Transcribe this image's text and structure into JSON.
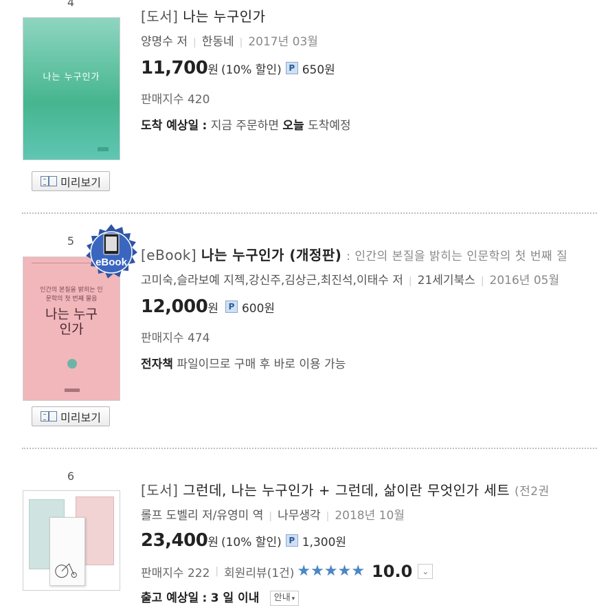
{
  "items": [
    {
      "rank": "4",
      "cover_title": "나는 누구인가",
      "preview_label": "미리보기",
      "category": "[도서]",
      "title": "나는 누구인가",
      "author": "양명수 저",
      "publisher": "한동네",
      "date": "2017년 03월",
      "price": "11,700",
      "won": "원",
      "discount": "(10% 할인)",
      "point_badge": "P",
      "points": "650원",
      "sales": "판매지수 420",
      "info_label": "도착 예상일",
      "info_colon": ":",
      "info_text1": "지금 주문하면",
      "info_bold": "오늘",
      "info_text2": "도착예정",
      "cover_color": "#5bbf9f"
    },
    {
      "rank": "5",
      "ebook_badge": "eBook",
      "cover_subtitle": "인간의 본질을 밝히는 인문학의 첫 번째 물음",
      "cover_title": "나는 누구인가",
      "preview_label": "미리보기",
      "category": "[eBook]",
      "title": "나는 누구인가 (개정판)",
      "subtitle": ": 인간의 본질을 밝히는 인문학의 첫 번째 질",
      "author": "고미숙,슬라보예 지젝,강신주,김상근,최진석,이태수 저",
      "publisher": "21세기북스",
      "date": "2016년 05월",
      "price": "12,000",
      "won": "원",
      "point_badge": "P",
      "points": "600원",
      "sales": "판매지수 474",
      "info_bold": "전자책",
      "info_text1": "파일이므로 구매 후 바로 이용 가능",
      "cover_color": "#f2b8bd"
    },
    {
      "rank": "6",
      "category": "[도서]",
      "title": "그런데, 나는 누구인가 + 그런데, 삶이란 무엇인가 세트",
      "subtitle": "(전2권",
      "author": "롤프 도벨리 저/유영미 역",
      "publisher": "나무생각",
      "date": "2018년 10월",
      "price": "23,400",
      "won": "원",
      "discount": "(10% 할인)",
      "point_badge": "P",
      "points": "1,300원",
      "sales": "판매지수 222",
      "reviews": "회원리뷰(1건)",
      "rating": "10.0",
      "rating_value": 5,
      "info_label": "출고 예상일",
      "info_colon": ":",
      "info_value": "3 일 이내",
      "guide_label": "안내"
    }
  ],
  "colors": {
    "accent": "#4b86c5",
    "point_badge": "#cfe0f3"
  }
}
